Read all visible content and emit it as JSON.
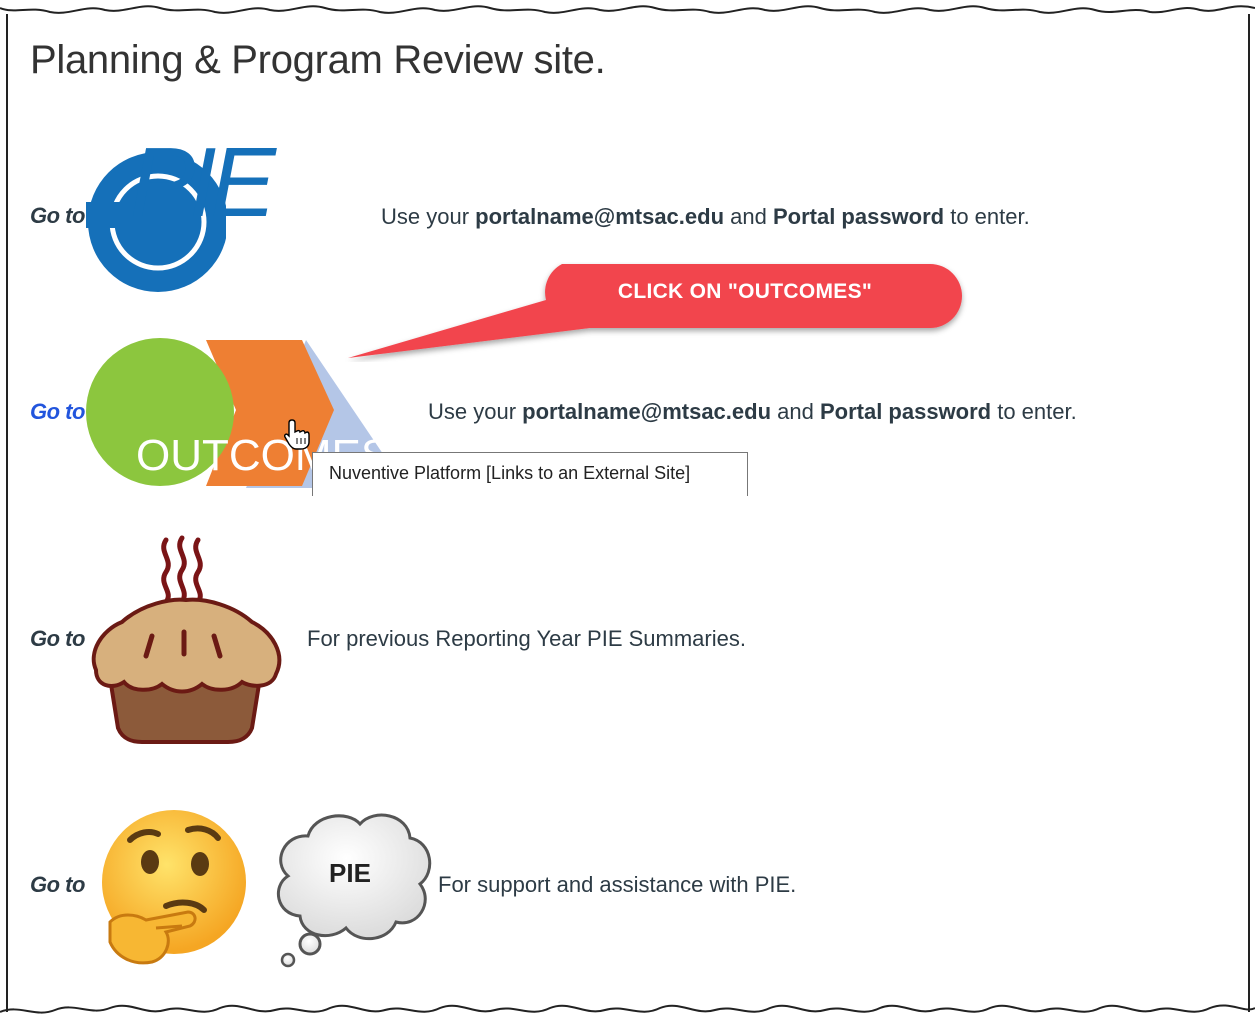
{
  "page": {
    "title": "Planning & Program Review site."
  },
  "rows": [
    {
      "goto": "Go to",
      "text_pre": "Use your ",
      "email": "portalname@mtsac.edu",
      "text_mid": " and ",
      "password": "Portal password",
      "text_post": " to enter."
    },
    {
      "goto": "Go to",
      "text_pre": "Use your ",
      "email": "portalname@mtsac.edu",
      "text_mid": " and ",
      "password": "Portal password",
      "text_post": " to enter."
    },
    {
      "goto": "Go to",
      "text": "For previous Reporting Year PIE Summaries."
    },
    {
      "goto": "Go to",
      "text": "For support and assistance with PIE."
    }
  ],
  "logos": {
    "pie_logo_text": "PIE",
    "outcomes_logo_text": "OUTCOMES",
    "cloud_text": "PIE"
  },
  "callout": {
    "label": "CLICK ON \"OUTCOMES\""
  },
  "tooltip": {
    "text": "Nuventive Platform [Links to an External Site]"
  },
  "icons": {
    "pie_logo": "pie-logo-icon",
    "outcomes_logo": "outcomes-logo-icon",
    "pie_dessert": "pie-dessert-icon",
    "thinking_face": "thinking-face-icon",
    "thought_cloud": "thought-cloud-icon",
    "cursor": "hand-pointer-icon"
  },
  "colors": {
    "pie_blue": "#1570b9",
    "outcomes_green": "#8cc63e",
    "outcomes_orange": "#ee7f33",
    "outcomes_lightblue": "#b4c6e7",
    "callout_red": "#f2454e",
    "link_blue": "#2255dd"
  }
}
